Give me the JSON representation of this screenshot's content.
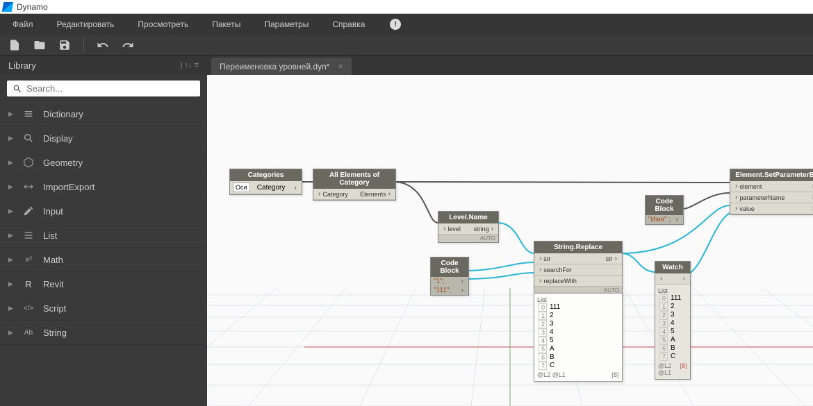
{
  "app": {
    "title": "Dynamo"
  },
  "menu": {
    "file": "Файл",
    "edit": "Редактировать",
    "view": "Просмотреть",
    "packages": "Пакеты",
    "settings": "Параметры",
    "help": "Справка",
    "info_symbol": "!"
  },
  "sidebar": {
    "title": "Library",
    "search_placeholder": "Search...",
    "items": [
      {
        "label": "Dictionary"
      },
      {
        "label": "Display"
      },
      {
        "label": "Geometry"
      },
      {
        "label": "ImportExport"
      },
      {
        "label": "Input"
      },
      {
        "label": "List"
      },
      {
        "label": "Math"
      },
      {
        "label": "Revit"
      },
      {
        "label": "Script"
      },
      {
        "label": "String"
      }
    ]
  },
  "tab": {
    "label": "Переименовка уровней.dyn*"
  },
  "nodes": {
    "categories": {
      "title": "Categories",
      "value": "Оси",
      "out": "Category"
    },
    "allElements": {
      "title": "All Elements of Category",
      "in": "Category",
      "out": "Elements"
    },
    "levelName": {
      "title": "Level.Name",
      "in": "level",
      "out": "string",
      "footer": "AUTO"
    },
    "codeBlock1": {
      "title": "Code Block",
      "line1": "\"Имя\" ;"
    },
    "codeBlock2": {
      "title": "Code Block",
      "line1": "\"1\";",
      "line2": "\"111\";"
    },
    "stringReplace": {
      "title": "String.Replace",
      "p1": "str",
      "p2": "searchFor",
      "p3": "replaceWith",
      "out": "str",
      "footer": "AUTO"
    },
    "watch": {
      "title": "Watch"
    },
    "setParam": {
      "title": "Element.SetParameterB",
      "p1": "element",
      "p2": "parameterName",
      "p3": "value"
    }
  },
  "watchData": {
    "label": "List",
    "rows": [
      {
        "i": "0",
        "v": "111"
      },
      {
        "i": "1",
        "v": "2"
      },
      {
        "i": "2",
        "v": "3"
      },
      {
        "i": "3",
        "v": "4"
      },
      {
        "i": "4",
        "v": "5"
      },
      {
        "i": "5",
        "v": "A"
      },
      {
        "i": "6",
        "v": "B"
      },
      {
        "i": "7",
        "v": "C"
      }
    ],
    "footerL": "@L2 @L1",
    "footerR": "{8}"
  }
}
